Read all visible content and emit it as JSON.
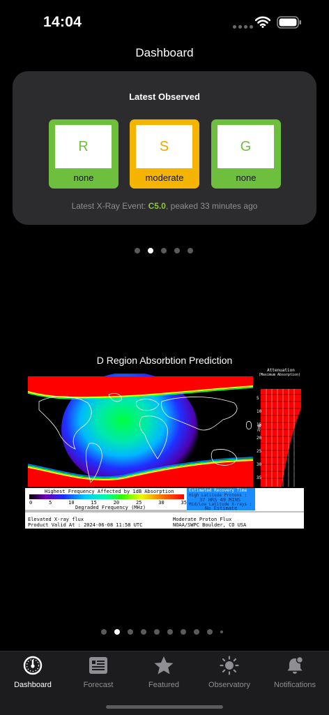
{
  "status": {
    "time": "14:04"
  },
  "title": "Dashboard",
  "latest": {
    "title": "Latest Observed",
    "scales": [
      {
        "letter": "R",
        "level": "none",
        "color": "#6fbf3f"
      },
      {
        "letter": "S",
        "level": "moderate",
        "color": "#f5b400"
      },
      {
        "letter": "G",
        "level": "none",
        "color": "#6fbf3f"
      }
    ],
    "xray_prefix": "Latest X-Ray Event: ",
    "xray_class": "C5.0",
    "xray_suffix": ", peaked 33 minutes ago"
  },
  "pager_top": {
    "count": 5,
    "active": 1
  },
  "drap": {
    "title": "D Region Absorbtion Prediction",
    "attenuation_title": "Attenuation",
    "attenuation_subtitle": "(Maximum Absorption)",
    "mhz_label": "MHz",
    "mhz_ticks": [
      "5",
      "10",
      "15",
      "20",
      "25",
      "30",
      "35"
    ],
    "db_label": "dB",
    "db_ticks": "0 5 10 15 20 25 30 35",
    "legend_title": "Highest Frequency Affected by 1dB Absorption",
    "legend_ticks": [
      "0",
      "5",
      "10",
      "15",
      "20",
      "25",
      "30",
      "35"
    ],
    "legend_xlabel": "Degraded Frequency (MHz)",
    "recovery_title": "Estimated Recovery Time",
    "recovery_high_label": "High Latitude Protons :",
    "recovery_high_value": "37 HRS 49 MINS",
    "recovery_mid_label": "Mid/Low Latitude X-rays :",
    "recovery_mid_value": "No Estimate",
    "footer_left_1": "Elevated X-ray flux",
    "footer_left_2": "Product Valid At : 2024-06-08 11:58 UTC",
    "footer_right_1": "Moderate Proton Flux",
    "footer_right_2": "NOAA/SWPC Boulder, CO USA"
  },
  "pager_bottom": {
    "count": 10,
    "active": 1
  },
  "tabs": [
    {
      "label": "Dashboard",
      "icon": "gauge-icon",
      "active": true
    },
    {
      "label": "Forecast",
      "icon": "newspaper-icon",
      "active": false
    },
    {
      "label": "Featured",
      "icon": "star-icon",
      "active": false
    },
    {
      "label": "Observatory",
      "icon": "sun-icon",
      "active": false
    },
    {
      "label": "Notifications",
      "icon": "bell-badge-icon",
      "active": false
    }
  ]
}
